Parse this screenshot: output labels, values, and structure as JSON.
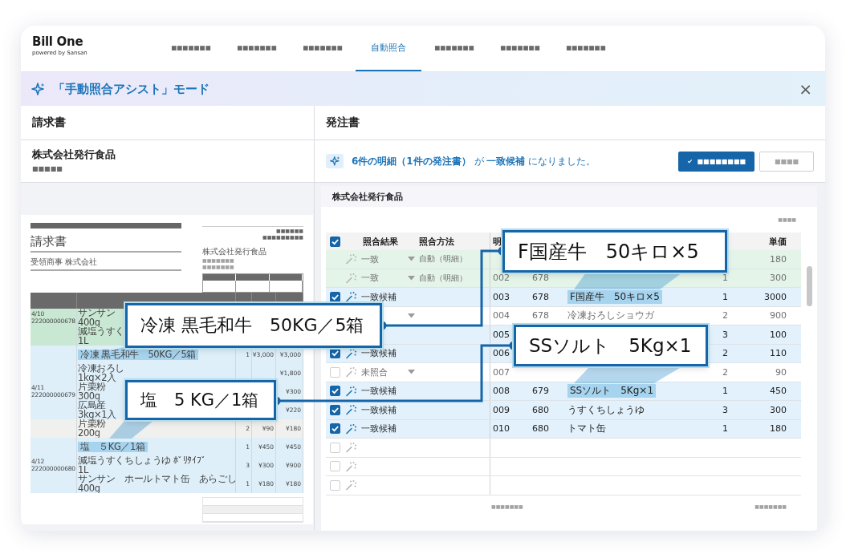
{
  "app": {
    "logo": "Bill One",
    "tagline": "powered by Sansan"
  },
  "tabs": [
    {
      "label": "■■■■■■■",
      "selected": false
    },
    {
      "label": "■■■■■■■",
      "selected": false
    },
    {
      "label": "■■■■■■■",
      "selected": false
    },
    {
      "label": "自動照合",
      "selected": true
    },
    {
      "label": "■■■■■■■",
      "selected": false
    },
    {
      "label": "■■■■■■■",
      "selected": false
    },
    {
      "label": "■■■■■■■",
      "selected": false
    }
  ],
  "banner": {
    "title": "「手動照合アシスト」モード",
    "close": "×"
  },
  "invoice_panel": {
    "heading": "請求書",
    "company": "株式会社発行食品",
    "company_sub": "■■■■■",
    "document": {
      "title": "請求書",
      "recipient": "受領商事 株式会社",
      "ref_lines": [
        "■■■■■■",
        "■■■■■■■■■"
      ],
      "issuer": "株式会社発行食品",
      "issuer_lines": [
        "■■■■■■■",
        "■■■■■■■"
      ],
      "rows": [
        {
          "kind": "matched",
          "date": "4/10\n222000000678",
          "item": "サンサン\n400g"
        },
        {
          "kind": "matched",
          "item": "減塩うすく\n1L"
        },
        {
          "kind": "candidate",
          "item": "冷凍 黒毛和牛　50KG／5箱",
          "highlighted": true,
          "qty": "1",
          "price": "¥3,000",
          "amount": "¥3,000"
        },
        {
          "kind": "candidate",
          "item": "冷凍おろし\n1kg×2入",
          "amount": "¥1,800"
        },
        {
          "kind": "candidate",
          "date": "4/11\n222000000679",
          "item": "片栗粉\n300g",
          "amount": "¥300"
        },
        {
          "kind": "candidate",
          "item": "広島産\n3kg×1入",
          "amount": "¥220"
        },
        {
          "kind": "none",
          "item": "片栗粉\n200g",
          "qty": "2",
          "price": "¥90",
          "amount": "¥180"
        },
        {
          "kind": "candidate",
          "item": "塩　５KG／1箱",
          "highlighted": true,
          "qty": "1",
          "price": "¥450",
          "amount": "¥450"
        },
        {
          "kind": "candidate",
          "date": "4/12\n222000000680",
          "item": "減塩うすくちしょうゆ ﾎﾟﾘﾀｲﾌﾟ\n1L",
          "qty": "3",
          "price": "¥300",
          "amount": "¥900"
        },
        {
          "kind": "candidate",
          "item": "サンサン　ホールトマト缶　あらごし\n400g",
          "qty": "1",
          "price": "¥180",
          "amount": "¥180"
        }
      ]
    }
  },
  "order_panel": {
    "heading": "発注書",
    "message": "**6件の明細（1件の発注書）** が **一致候補** になりました。",
    "buttons": [
      {
        "label": "■■■■■■■■",
        "kind": "primary"
      },
      {
        "label": "■■■■",
        "kind": "secondary"
      }
    ],
    "company": "株式会社発行食品",
    "count": "■■■■",
    "table": {
      "header_checked": true,
      "columns": {
        "result": "照合結果",
        "method": "照合方法",
        "number": "明",
        "price": "単価"
      },
      "rows": [
        {
          "kind": "matched",
          "disabled": true,
          "assist_active": false,
          "result": "一致",
          "dropdown": true,
          "method": "自動（明細）",
          "price": "180"
        },
        {
          "kind": "matched",
          "disabled": true,
          "assist_active": false,
          "result": "一致",
          "dropdown": true,
          "method": "自動（明細）",
          "number": "002",
          "code": "678",
          "qty": "1",
          "price": "300"
        },
        {
          "kind": "candidate",
          "checked": true,
          "assist_active": true,
          "result": "一致候補",
          "number": "003",
          "code": "678",
          "item": "F国産牛　50キロ×5",
          "highlighted": true,
          "qty": "1",
          "price": "3000"
        },
        {
          "kind": "none",
          "disabled": true,
          "dropdown": true,
          "number": "004",
          "code": "678",
          "item": "冷凍おろしショウガ",
          "qty": "2",
          "price": "900"
        },
        {
          "kind": "candidate",
          "number": "005",
          "qty": "3",
          "price": "100"
        },
        {
          "kind": "candidate",
          "checked": true,
          "assist_active": true,
          "result": "一致候補",
          "number": "006",
          "qty": "2",
          "price": "110"
        },
        {
          "kind": "none",
          "disabled": true,
          "checked": false,
          "assist_active": false,
          "result": "未照合",
          "dropdown": true,
          "number": "007",
          "qty": "2",
          "price": "90"
        },
        {
          "kind": "candidate",
          "checked": true,
          "assist_active": true,
          "result": "一致候補",
          "number": "008",
          "code": "679",
          "item": "SSソルト　5Kg×1",
          "highlighted": true,
          "qty": "1",
          "price": "450"
        },
        {
          "kind": "candidate",
          "checked": true,
          "assist_active": true,
          "result": "一致候補",
          "number": "009",
          "code": "680",
          "item": "うすくちしょうゆ",
          "qty": "3",
          "price": "300"
        },
        {
          "kind": "candidate",
          "checked": true,
          "assist_active": true,
          "result": "一致候補",
          "number": "010",
          "code": "680",
          "item": "トマト缶",
          "qty": "1",
          "price": "180"
        },
        {
          "kind": "empty",
          "checked": false,
          "assist_active": false
        },
        {
          "kind": "empty",
          "checked": false,
          "assist_active": false
        },
        {
          "kind": "empty",
          "checked": false,
          "assist_active": false
        }
      ]
    },
    "footer": [
      "■■■■■■■",
      "■■■■■■■"
    ]
  },
  "callouts": [
    {
      "text": "冷凍 黒毛和牛　50KG／5箱"
    },
    {
      "text": "塩　5 KG／1箱"
    },
    {
      "text": "F国産牛　50キロ×5"
    },
    {
      "text": "SSソルト　5Kg×1"
    }
  ]
}
